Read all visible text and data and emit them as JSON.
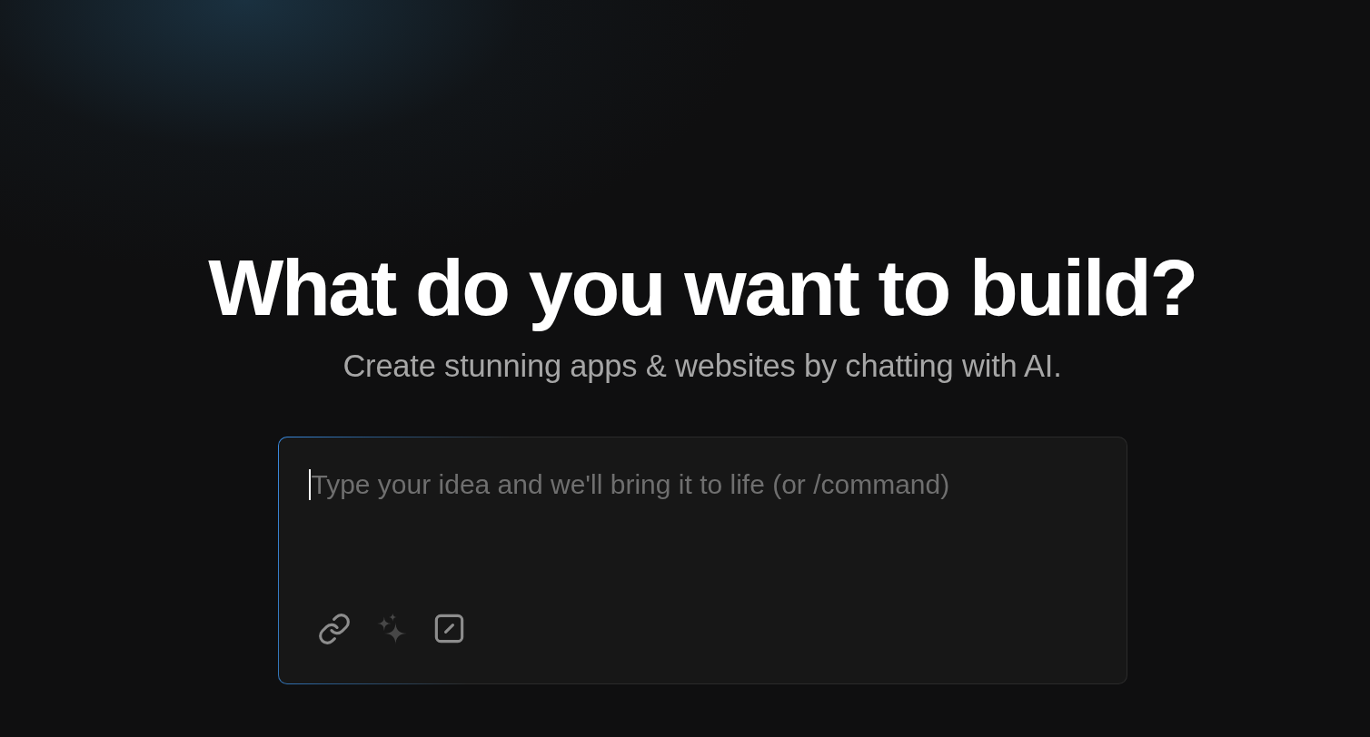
{
  "hero": {
    "title": "What do you want to build?",
    "subtitle": "Create stunning apps & websites by chatting with AI."
  },
  "prompt": {
    "placeholder": "Type your idea and we'll bring it to life (or /command)",
    "focused": true,
    "tools": [
      {
        "kind": "link",
        "disabled": false
      },
      {
        "kind": "sparkles",
        "disabled": true
      },
      {
        "kind": "command",
        "disabled": false
      }
    ]
  }
}
